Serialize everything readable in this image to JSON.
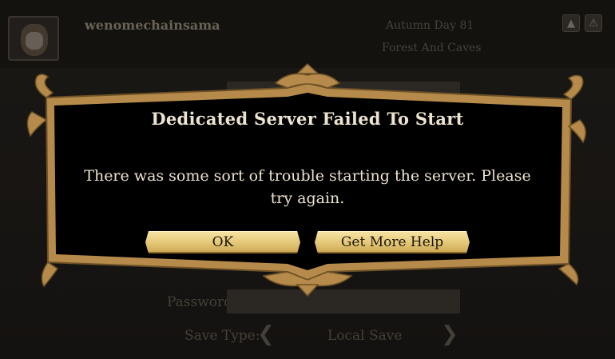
{
  "header": {
    "username": "wenomechainsama",
    "season_day": "Autumn Day 81",
    "world": "Forest And Caves"
  },
  "form": {
    "password_label": "Password",
    "save_type_label": "Save Type:",
    "save_type_value": "Local Save"
  },
  "dialog": {
    "title": "Dedicated Server Failed To Start",
    "message": "There was some sort of trouble starting the server. Please try again.",
    "ok_label": "OK",
    "help_label": "Get More Help"
  },
  "colors": {
    "frame": "#b58a4a",
    "dialog_bg": "#000000",
    "text": "#ece3d0",
    "button": "#e4c877"
  },
  "icons": {
    "top_right_1": "up-arrow-icon",
    "top_right_2": "warning-bell-icon",
    "left_arrow": "chevron-left-icon",
    "right_arrow": "chevron-right-icon"
  }
}
